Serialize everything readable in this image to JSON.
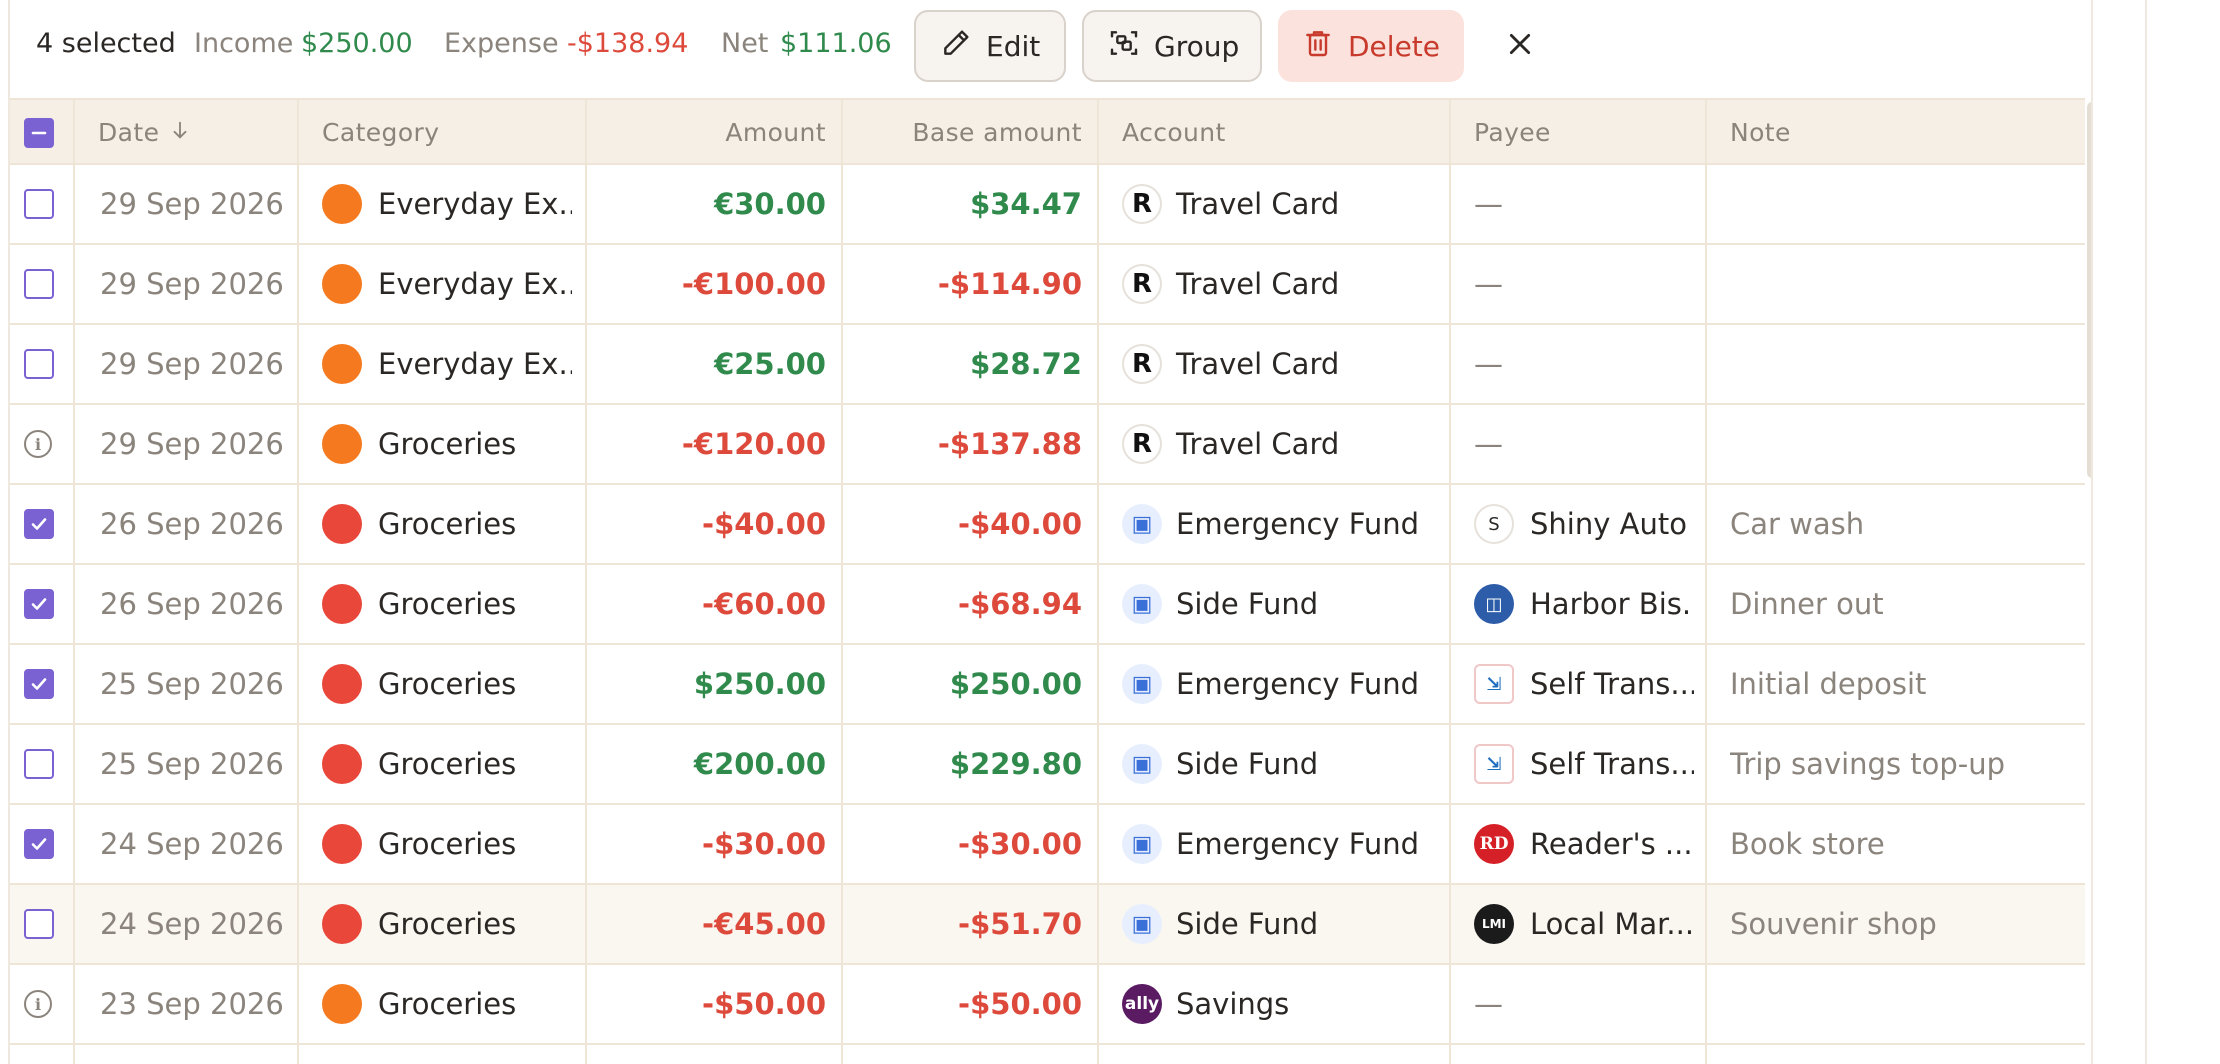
{
  "toolbar": {
    "selected": "4 selected",
    "income_label": "Income",
    "income_value": "$250.00",
    "expense_label": "Expense",
    "expense_value": "-$138.94",
    "net_label": "Net",
    "net_value": "$111.06",
    "edit_label": "Edit",
    "group_label": "Group",
    "delete_label": "Delete",
    "icons": [
      "pencil-icon",
      "group-select-icon",
      "trash-icon",
      "close-icon"
    ]
  },
  "table": {
    "columns": {
      "date": "Date",
      "category": "Category",
      "amount": "Amount",
      "base_amount": "Base amount",
      "account": "Account",
      "payee": "Payee",
      "note": "Note"
    },
    "sort": "descending",
    "rows": [
      {
        "state": "unchecked",
        "date": "29 Sep 2026",
        "category": "Everyday Ex...",
        "cat_color": "#f57a1f",
        "amount": "€30.00",
        "base": "$34.47",
        "sign": "pos",
        "account": "Travel Card",
        "acc_icon": "R",
        "acc_type": "travel",
        "payee": "—",
        "pay_icon": "",
        "pay_type": "",
        "note": ""
      },
      {
        "state": "unchecked",
        "date": "29 Sep 2026",
        "category": "Everyday Ex...",
        "cat_color": "#f57a1f",
        "amount": "-€100.00",
        "base": "-$114.90",
        "sign": "neg",
        "account": "Travel Card",
        "acc_icon": "R",
        "acc_type": "travel",
        "payee": "—",
        "pay_icon": "",
        "pay_type": "",
        "note": ""
      },
      {
        "state": "unchecked",
        "date": "29 Sep 2026",
        "category": "Everyday Ex...",
        "cat_color": "#f57a1f",
        "amount": "€25.00",
        "base": "$28.72",
        "sign": "pos",
        "account": "Travel Card",
        "acc_icon": "R",
        "acc_type": "travel",
        "payee": "—",
        "pay_icon": "",
        "pay_type": "",
        "note": ""
      },
      {
        "state": "info",
        "date": "29 Sep 2026",
        "category": "Groceries",
        "cat_color": "#f57a1f",
        "amount": "-€120.00",
        "base": "-$137.88",
        "sign": "neg",
        "account": "Travel Card",
        "acc_icon": "R",
        "acc_type": "travel",
        "payee": "—",
        "pay_icon": "",
        "pay_type": "",
        "note": ""
      },
      {
        "state": "checked",
        "date": "26 Sep 2026",
        "category": "Groceries",
        "cat_color": "#e8473a",
        "amount": "-$40.00",
        "base": "-$40.00",
        "sign": "neg",
        "account": "Emergency Fund",
        "acc_icon": "▣",
        "acc_type": "fund",
        "payee": "Shiny Auto",
        "pay_icon": "S",
        "pay_type": "s",
        "note": "Car wash"
      },
      {
        "state": "checked",
        "date": "26 Sep 2026",
        "category": "Groceries",
        "cat_color": "#e8473a",
        "amount": "-€60.00",
        "base": "-$68.94",
        "sign": "neg",
        "account": "Side Fund",
        "acc_icon": "▣",
        "acc_type": "fund",
        "payee": "Harbor Bis...",
        "pay_icon": "◫",
        "pay_type": "harbor",
        "note": "Dinner out"
      },
      {
        "state": "checked",
        "date": "25 Sep 2026",
        "category": "Groceries",
        "cat_color": "#e8473a",
        "amount": "$250.00",
        "base": "$250.00",
        "sign": "pos",
        "account": "Emergency Fund",
        "acc_icon": "▣",
        "acc_type": "fund",
        "payee": "Self Trans...",
        "pay_icon": "⇲",
        "pay_type": "self",
        "note": "Initial deposit"
      },
      {
        "state": "unchecked",
        "date": "25 Sep 2026",
        "category": "Groceries",
        "cat_color": "#e8473a",
        "amount": "€200.00",
        "base": "$229.80",
        "sign": "pos",
        "account": "Side Fund",
        "acc_icon": "▣",
        "acc_type": "fund",
        "payee": "Self Trans...",
        "pay_icon": "⇲",
        "pay_type": "self",
        "note": "Trip savings top-up"
      },
      {
        "state": "checked",
        "date": "24 Sep 2026",
        "category": "Groceries",
        "cat_color": "#e8473a",
        "amount": "-$30.00",
        "base": "-$30.00",
        "sign": "neg",
        "account": "Emergency Fund",
        "acc_icon": "▣",
        "acc_type": "fund",
        "payee": "Reader's ...",
        "pay_icon": "RD",
        "pay_type": "rd",
        "note": "Book store"
      },
      {
        "state": "unchecked",
        "hover": true,
        "date": "24 Sep 2026",
        "category": "Groceries",
        "cat_color": "#e8473a",
        "amount": "-€45.00",
        "base": "-$51.70",
        "sign": "neg",
        "account": "Side Fund",
        "acc_icon": "▣",
        "acc_type": "fund",
        "payee": "Local Mar...",
        "pay_icon": "LMI",
        "pay_type": "lm",
        "note": "Souvenir shop"
      },
      {
        "state": "info",
        "date": "23 Sep 2026",
        "category": "Groceries",
        "cat_color": "#f57a1f",
        "amount": "-$50.00",
        "base": "-$50.00",
        "sign": "neg",
        "account": "Savings",
        "acc_icon": "ally",
        "acc_type": "ally",
        "payee": "—",
        "pay_icon": "",
        "pay_type": "",
        "note": ""
      }
    ]
  }
}
